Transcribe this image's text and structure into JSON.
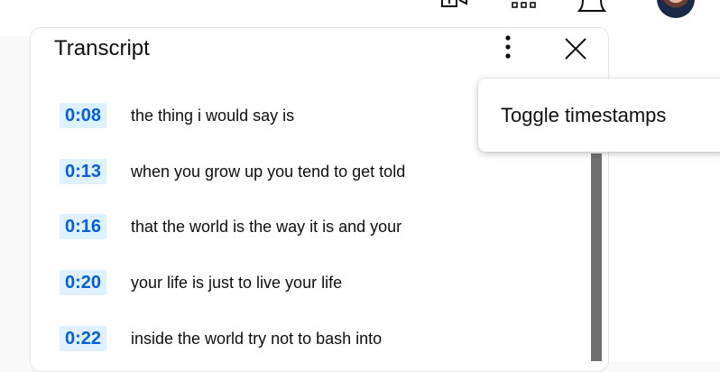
{
  "header": {
    "icons": [
      "create-icon",
      "apps-icon",
      "notifications-icon"
    ],
    "avatar": "avatar"
  },
  "transcript": {
    "title": "Transcript",
    "segments": [
      {
        "time": "0:08",
        "text": "the thing i would say is"
      },
      {
        "time": "0:13",
        "text": "when you grow up you tend to get told"
      },
      {
        "time": "0:16",
        "text": "that the world is the way it is and your"
      },
      {
        "time": "0:20",
        "text": "your life is just to live your life"
      },
      {
        "time": "0:22",
        "text": "inside the world try not to bash into"
      }
    ]
  },
  "menu": {
    "items": [
      {
        "label": "Toggle timestamps"
      }
    ]
  },
  "colors": {
    "timestamp_bg": "#def1ff",
    "timestamp_text": "#065fd4",
    "scrollbar": "#717171"
  }
}
